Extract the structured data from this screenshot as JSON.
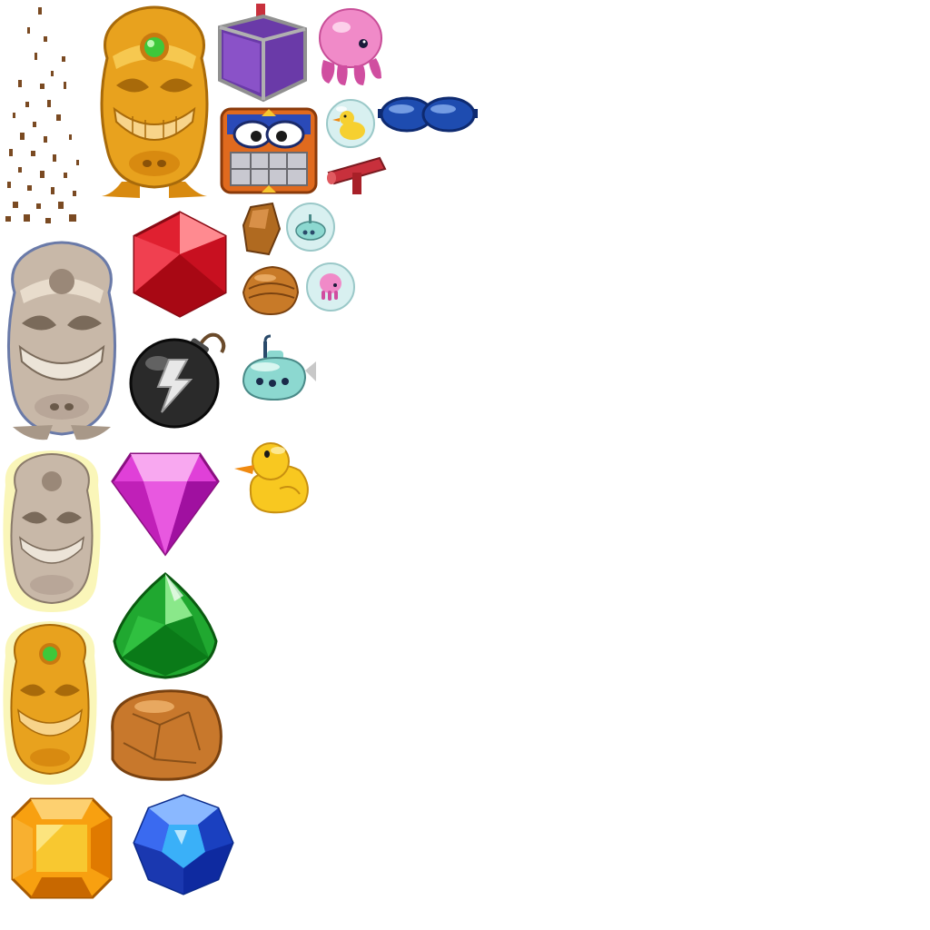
{
  "sprite_sheet": {
    "background": "#ffffff",
    "sprites": [
      {
        "icon": "dirt-particles-icon",
        "color": "#7a4a22"
      },
      {
        "icon": "gold-tiki-idol-icon",
        "color": "#e8a21e"
      },
      {
        "icon": "purple-crate-plunger-icon",
        "color": "#6a3aa8"
      },
      {
        "icon": "pink-octopus-icon",
        "color": "#f08ac8"
      },
      {
        "icon": "angry-stone-block-icon",
        "color": "#e06a1e"
      },
      {
        "icon": "duck-bubble-icon",
        "color": "#f6d030"
      },
      {
        "icon": "blue-goggles-icon",
        "color": "#1e4cb0"
      },
      {
        "icon": "red-pipe-handle-icon",
        "color": "#c8303c"
      },
      {
        "icon": "red-gem-icon",
        "color": "#e02030"
      },
      {
        "icon": "rock-shard-small-icon",
        "color": "#b06a20"
      },
      {
        "icon": "submarine-bubble-icon",
        "color": "#a8e0e0"
      },
      {
        "icon": "stone-tiki-idol-icon",
        "color": "#c8b8a8"
      },
      {
        "icon": "walnut-rock-icon",
        "color": "#c87a28"
      },
      {
        "icon": "octopus-bubble-icon",
        "color": "#f08ac8"
      },
      {
        "icon": "black-bomb-icon",
        "color": "#2a2a2a"
      },
      {
        "icon": "submarine-icon",
        "color": "#8cd8d0"
      },
      {
        "icon": "stone-tiki-idol-glow-icon",
        "color": "#f6f08a"
      },
      {
        "icon": "pink-diamond-gem-icon",
        "color": "#e040d8"
      },
      {
        "icon": "rubber-duck-icon",
        "color": "#f8c820"
      },
      {
        "icon": "green-gem-icon",
        "color": "#20a830"
      },
      {
        "icon": "gold-tiki-idol-glow-icon",
        "color": "#f6f08a"
      },
      {
        "icon": "large-rock-icon",
        "color": "#c8782c"
      },
      {
        "icon": "orange-square-gem-icon",
        "color": "#f8a010"
      },
      {
        "icon": "blue-round-gem-icon",
        "color": "#2050e0"
      }
    ]
  }
}
